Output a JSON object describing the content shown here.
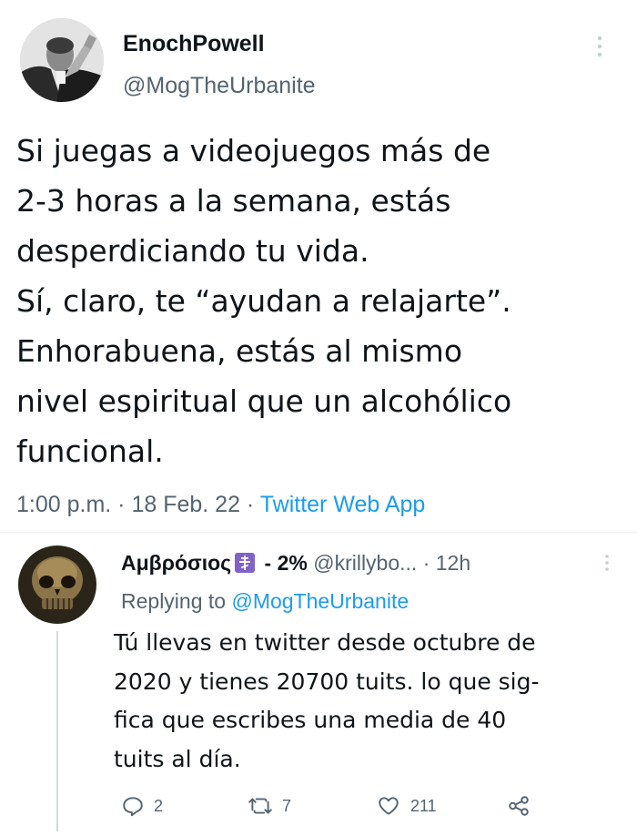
{
  "tweet": {
    "display_name": "EnochPowell",
    "handle": "@MogTheUrbanite",
    "body_lines": [
      "Si juegas a videojuegos más de",
      "2-3 horas a la semana, estás",
      "desperdiciando tu vida.",
      "Sí, claro, te “ayudan a relajarte”.",
      "Enhorabuena, estás al mismo",
      "nivel espiritual que un alcohólico",
      "funcional."
    ],
    "time": "1:00 p.m.",
    "sep1": " · ",
    "date": "18 Feb. 22",
    "sep2": " · ",
    "source": "Twitter Web App"
  },
  "reply": {
    "display_name": "Αμβρόσιος",
    "name_suffix": " - 2%",
    "handle": " @krillybo...",
    "time_sep": " · ",
    "time": "12h",
    "replying_prefix": "Replying to ",
    "replying_to": "@MogTheUrbanite",
    "body_lines": [
      "Tú llevas en twitter desde octubre de",
      "2020 y tienes 20700 tuits. lo que sig-",
      "fica que escribes una media de 40",
      "tuits al día."
    ],
    "actions": {
      "reply_count": "2",
      "retweet_count": "7",
      "like_count": "211"
    }
  },
  "icons": {
    "more": "more-vertical-icon",
    "cross": "orthodox-cross-icon",
    "reply": "reply-icon",
    "retweet": "retweet-icon",
    "like": "heart-icon",
    "share": "share-icon"
  },
  "colors": {
    "text": "#0f1419",
    "secondary": "#536471",
    "accent": "#1d9bf0",
    "badge": "#7f63c7",
    "divider": "#eff3f4"
  }
}
